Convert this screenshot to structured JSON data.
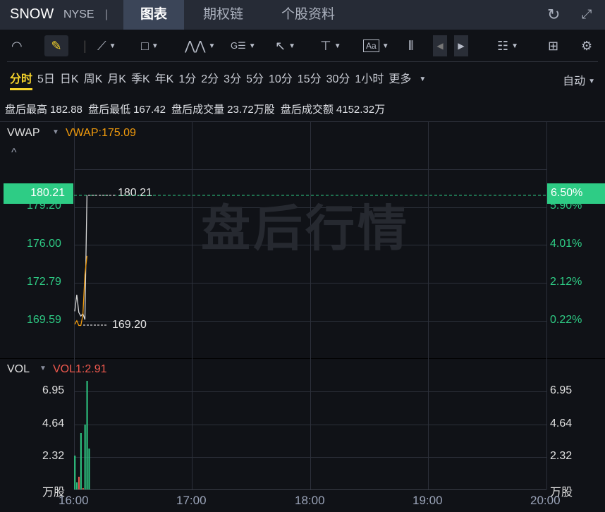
{
  "header": {
    "symbol": "SNOW",
    "exchange": "NYSE",
    "divider": "|",
    "tabs": [
      {
        "label": "图表",
        "active": true
      },
      {
        "label": "期权链"
      },
      {
        "label": "个股资料"
      }
    ],
    "refresh_icon": "refresh-icon",
    "fullscreen_icon": "fullscreen-icon"
  },
  "toolbar": {
    "icons": [
      "gauge-icon",
      "pencil-icon",
      "line-tool-icon",
      "rectangle-icon",
      "pattern-icon",
      "fibonacci-icon",
      "arrow-icon",
      "measure-icon",
      "text-icon",
      "candlestick-icon",
      "prev-icon",
      "next-icon",
      "indicator-list-icon",
      "layout-grid-icon",
      "gear-icon"
    ],
    "text_tool": "Aa",
    "fib_label": "G"
  },
  "periods": {
    "items": [
      "分时",
      "5日",
      "日K",
      "周K",
      "月K",
      "季K",
      "年K",
      "1分",
      "2分",
      "3分",
      "5分",
      "10分",
      "15分",
      "30分",
      "1小时",
      "更多"
    ],
    "active": "分时",
    "mode": "自动"
  },
  "stats": [
    {
      "label": "盘后最高",
      "value": "182.88"
    },
    {
      "label": "盘后最低",
      "value": "167.42"
    },
    {
      "label": "盘后成交量",
      "value": "23.72万股"
    },
    {
      "label": "盘后成交额",
      "value": "4152.32万"
    }
  ],
  "main": {
    "indicator": "VWAP",
    "indicator_value": "VWAP:175.09",
    "collapse": "^",
    "watermark": "盘后行情",
    "current_price": "180.21",
    "current_pct": "6.50%",
    "high_marker": "180.21",
    "low_marker": "169.20",
    "y_left": [
      "179.20",
      "176.00",
      "172.79",
      "169.59"
    ],
    "y_right": [
      "5.90%",
      "4.01%",
      "2.12%",
      "0.22%"
    ]
  },
  "volume": {
    "indicator": "VOL",
    "indicator_value": "VOL1:2.91",
    "y_left": [
      "6.95",
      "4.64",
      "2.32",
      "万股"
    ],
    "y_right": [
      "6.95",
      "4.64",
      "2.32",
      "万股"
    ]
  },
  "x_labels": [
    "16:00",
    "17:00",
    "18:00",
    "19:00",
    "20:00"
  ],
  "chart_data": {
    "type": "line",
    "price_range": [
      169.2,
      180.21
    ],
    "x_range": [
      "16:00",
      "20:00"
    ],
    "price": {
      "times": [
        "16:00",
        "16:01",
        "16:02",
        "16:03",
        "16:04",
        "16:05",
        "16:06"
      ],
      "values": [
        170.4,
        171.8,
        170.3,
        170.0,
        170.2,
        169.7,
        180.21
      ]
    },
    "vwap": {
      "times": [
        "16:00",
        "16:01",
        "16:02",
        "16:03",
        "16:04",
        "16:05",
        "16:06"
      ],
      "values": [
        169.3,
        169.6,
        169.2,
        169.2,
        170.1,
        173.5,
        175.09
      ]
    },
    "vol": {
      "times": [
        "16:00",
        "16:01",
        "16:02",
        "16:03",
        "16:04",
        "16:05",
        "16:06",
        "16:07"
      ],
      "values": [
        2.4,
        0.5,
        0.9,
        4.0,
        0.1,
        4.6,
        7.7,
        2.9
      ],
      "up": [
        true,
        true,
        false,
        true,
        false,
        true,
        true,
        true
      ]
    },
    "colors": {
      "price": "#d8d8d8",
      "vwap": "#f29b0c",
      "up": "#2ecc85",
      "down": "#f0594e"
    }
  }
}
